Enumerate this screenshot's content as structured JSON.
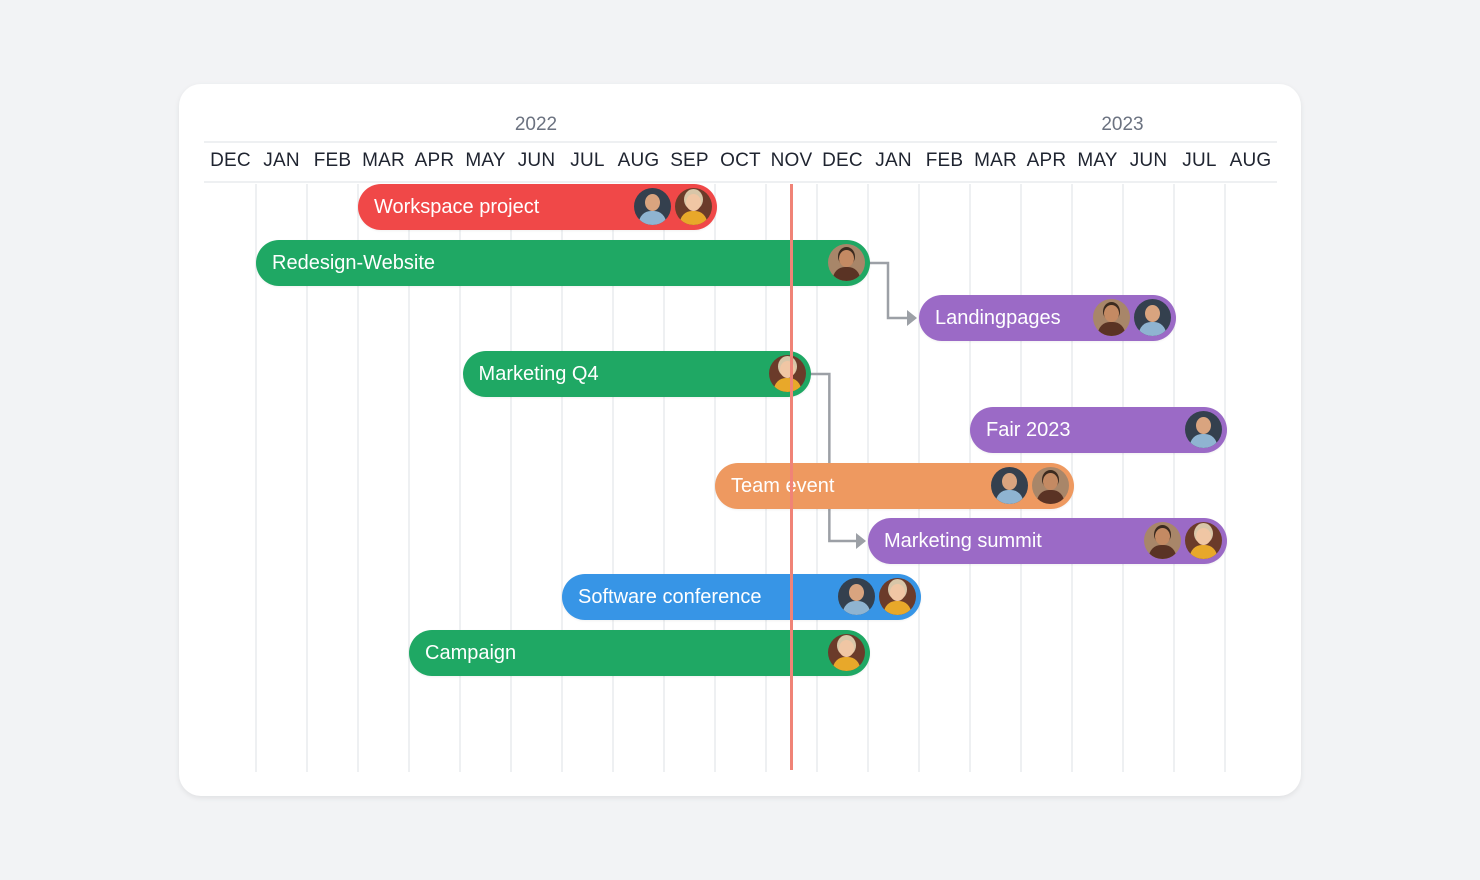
{
  "chart_data": {
    "type": "gantt",
    "title": "",
    "years": [
      {
        "label": "2022",
        "center_month_index": 6
      },
      {
        "label": "2023",
        "center_month_index": 17.5
      }
    ],
    "months": [
      "DEC",
      "JAN",
      "FEB",
      "MAR",
      "APR",
      "MAY",
      "JUN",
      "JUL",
      "AUG",
      "SEP",
      "OCT",
      "NOV",
      "DEC",
      "JAN",
      "FEB",
      "MAR",
      "APR",
      "MAY",
      "JUN",
      "JUL",
      "AUG"
    ],
    "month_range": {
      "start": "2021-12",
      "end": "2023-08"
    },
    "today": {
      "month_index": 11.5,
      "label": "Nov 2022",
      "color": "#f08377"
    },
    "tasks": [
      {
        "name": "Workspace project",
        "start": 3,
        "end": 10,
        "start_label": "Mar 2022",
        "end_label": "Sep 2022",
        "color": "#f04848",
        "assignees": [
          "man1",
          "woman"
        ]
      },
      {
        "name": "Redesign-Website",
        "start": 1,
        "end": 13,
        "start_label": "Jan 2022",
        "end_label": "Dec 2022",
        "color": "#1fa864",
        "assignees": [
          "man2"
        ]
      },
      {
        "name": "Landingpages",
        "start": 14,
        "end": 19,
        "start_label": "Feb 2023",
        "end_label": "Jun 2023",
        "color": "#9b6ac6",
        "assignees": [
          "man2",
          "man1"
        ]
      },
      {
        "name": "Marketing Q4",
        "start": 5.05,
        "end": 11.85,
        "start_label": "May 2022",
        "end_label": "Nov 2022",
        "color": "#1fa864",
        "assignees": [
          "woman"
        ]
      },
      {
        "name": "Fair 2023",
        "start": 15,
        "end": 20,
        "start_label": "Mar 2023",
        "end_label": "Jul 2023",
        "color": "#9b6ac6",
        "assignees": [
          "man1"
        ]
      },
      {
        "name": "Team event",
        "start": 10,
        "end": 17,
        "start_label": "Oct 2022",
        "end_label": "Apr 2023",
        "color": "#ee9960",
        "assignees": [
          "man1",
          "man2"
        ]
      },
      {
        "name": "Marketing summit",
        "start": 13,
        "end": 20,
        "start_label": "Jan 2023",
        "end_label": "Jul 2023",
        "color": "#9b6ac6",
        "assignees": [
          "man2",
          "woman"
        ]
      },
      {
        "name": "Software conference",
        "start": 7,
        "end": 14,
        "start_label": "Jul 2022",
        "end_label": "Jan 2023",
        "color": "#3795e6",
        "assignees": [
          "man1",
          "woman"
        ]
      },
      {
        "name": "Campaign",
        "start": 4,
        "end": 13,
        "start_label": "Apr 2022",
        "end_label": "Dec 2022",
        "color": "#1fa864",
        "assignees": [
          "woman"
        ]
      }
    ],
    "dependencies": [
      {
        "from": "Redesign-Website",
        "to": "Landingpages"
      },
      {
        "from": "Marketing Q4",
        "to": "Marketing summit"
      }
    ],
    "link_color": "#9ca0a6"
  }
}
